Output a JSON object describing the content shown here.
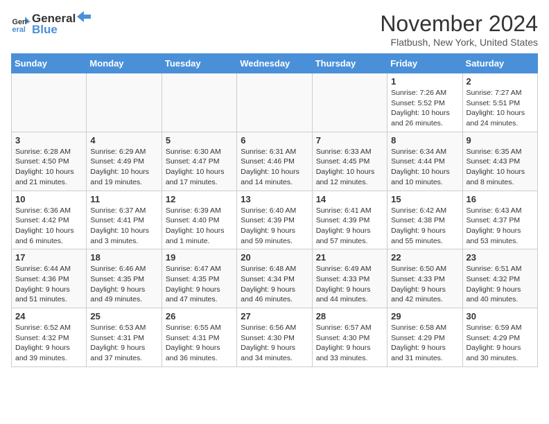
{
  "logo": {
    "line1": "General",
    "line2": "Blue"
  },
  "title": "November 2024",
  "location": "Flatbush, New York, United States",
  "days_of_week": [
    "Sunday",
    "Monday",
    "Tuesday",
    "Wednesday",
    "Thursday",
    "Friday",
    "Saturday"
  ],
  "weeks": [
    [
      {
        "day": "",
        "info": ""
      },
      {
        "day": "",
        "info": ""
      },
      {
        "day": "",
        "info": ""
      },
      {
        "day": "",
        "info": ""
      },
      {
        "day": "",
        "info": ""
      },
      {
        "day": "1",
        "info": "Sunrise: 7:26 AM\nSunset: 5:52 PM\nDaylight: 10 hours and 26 minutes."
      },
      {
        "day": "2",
        "info": "Sunrise: 7:27 AM\nSunset: 5:51 PM\nDaylight: 10 hours and 24 minutes."
      }
    ],
    [
      {
        "day": "3",
        "info": "Sunrise: 6:28 AM\nSunset: 4:50 PM\nDaylight: 10 hours and 21 minutes."
      },
      {
        "day": "4",
        "info": "Sunrise: 6:29 AM\nSunset: 4:49 PM\nDaylight: 10 hours and 19 minutes."
      },
      {
        "day": "5",
        "info": "Sunrise: 6:30 AM\nSunset: 4:47 PM\nDaylight: 10 hours and 17 minutes."
      },
      {
        "day": "6",
        "info": "Sunrise: 6:31 AM\nSunset: 4:46 PM\nDaylight: 10 hours and 14 minutes."
      },
      {
        "day": "7",
        "info": "Sunrise: 6:33 AM\nSunset: 4:45 PM\nDaylight: 10 hours and 12 minutes."
      },
      {
        "day": "8",
        "info": "Sunrise: 6:34 AM\nSunset: 4:44 PM\nDaylight: 10 hours and 10 minutes."
      },
      {
        "day": "9",
        "info": "Sunrise: 6:35 AM\nSunset: 4:43 PM\nDaylight: 10 hours and 8 minutes."
      }
    ],
    [
      {
        "day": "10",
        "info": "Sunrise: 6:36 AM\nSunset: 4:42 PM\nDaylight: 10 hours and 6 minutes."
      },
      {
        "day": "11",
        "info": "Sunrise: 6:37 AM\nSunset: 4:41 PM\nDaylight: 10 hours and 3 minutes."
      },
      {
        "day": "12",
        "info": "Sunrise: 6:39 AM\nSunset: 4:40 PM\nDaylight: 10 hours and 1 minute."
      },
      {
        "day": "13",
        "info": "Sunrise: 6:40 AM\nSunset: 4:39 PM\nDaylight: 9 hours and 59 minutes."
      },
      {
        "day": "14",
        "info": "Sunrise: 6:41 AM\nSunset: 4:39 PM\nDaylight: 9 hours and 57 minutes."
      },
      {
        "day": "15",
        "info": "Sunrise: 6:42 AM\nSunset: 4:38 PM\nDaylight: 9 hours and 55 minutes."
      },
      {
        "day": "16",
        "info": "Sunrise: 6:43 AM\nSunset: 4:37 PM\nDaylight: 9 hours and 53 minutes."
      }
    ],
    [
      {
        "day": "17",
        "info": "Sunrise: 6:44 AM\nSunset: 4:36 PM\nDaylight: 9 hours and 51 minutes."
      },
      {
        "day": "18",
        "info": "Sunrise: 6:46 AM\nSunset: 4:35 PM\nDaylight: 9 hours and 49 minutes."
      },
      {
        "day": "19",
        "info": "Sunrise: 6:47 AM\nSunset: 4:35 PM\nDaylight: 9 hours and 47 minutes."
      },
      {
        "day": "20",
        "info": "Sunrise: 6:48 AM\nSunset: 4:34 PM\nDaylight: 9 hours and 46 minutes."
      },
      {
        "day": "21",
        "info": "Sunrise: 6:49 AM\nSunset: 4:33 PM\nDaylight: 9 hours and 44 minutes."
      },
      {
        "day": "22",
        "info": "Sunrise: 6:50 AM\nSunset: 4:33 PM\nDaylight: 9 hours and 42 minutes."
      },
      {
        "day": "23",
        "info": "Sunrise: 6:51 AM\nSunset: 4:32 PM\nDaylight: 9 hours and 40 minutes."
      }
    ],
    [
      {
        "day": "24",
        "info": "Sunrise: 6:52 AM\nSunset: 4:32 PM\nDaylight: 9 hours and 39 minutes."
      },
      {
        "day": "25",
        "info": "Sunrise: 6:53 AM\nSunset: 4:31 PM\nDaylight: 9 hours and 37 minutes."
      },
      {
        "day": "26",
        "info": "Sunrise: 6:55 AM\nSunset: 4:31 PM\nDaylight: 9 hours and 36 minutes."
      },
      {
        "day": "27",
        "info": "Sunrise: 6:56 AM\nSunset: 4:30 PM\nDaylight: 9 hours and 34 minutes."
      },
      {
        "day": "28",
        "info": "Sunrise: 6:57 AM\nSunset: 4:30 PM\nDaylight: 9 hours and 33 minutes."
      },
      {
        "day": "29",
        "info": "Sunrise: 6:58 AM\nSunset: 4:29 PM\nDaylight: 9 hours and 31 minutes."
      },
      {
        "day": "30",
        "info": "Sunrise: 6:59 AM\nSunset: 4:29 PM\nDaylight: 9 hours and 30 minutes."
      }
    ]
  ]
}
